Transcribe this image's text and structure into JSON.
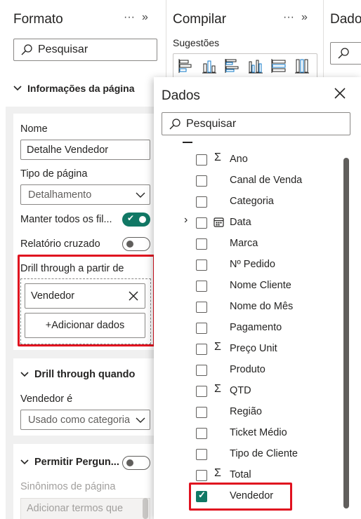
{
  "format_pane": {
    "title": "Formato",
    "more_label": "···",
    "collapse_label": "»",
    "search_placeholder": "Pesquisar",
    "section_title": "Informações da página",
    "name_label": "Nome",
    "name_value": "Detalhe Vendedor",
    "page_type_label": "Tipo de página",
    "page_type_value": "Detalhamento",
    "keep_filters_label": "Manter todos os fil...",
    "cross_report_label": "Relatório cruzado",
    "drill_from_label": "Drill through a partir de",
    "drill_field": "Vendedor",
    "add_data_label": "+Adicionar dados",
    "drill_when_title": "Drill through quando",
    "drill_when_field_label": "Vendedor é",
    "drill_when_value": "Usado como categoria",
    "allow_questions_title": "Permitir Pergun...",
    "synonyms_label": "Sinônimos de página",
    "synonyms_placeholder": "Adicionar termos que"
  },
  "build_pane": {
    "title": "Compilar",
    "more_label": "···",
    "collapse_label": "»",
    "suggestions_label": "Sugestões"
  },
  "data_pane": {
    "title": "Dados"
  },
  "flyout": {
    "title": "Dados",
    "search_placeholder": "Pesquisar",
    "items": [
      {
        "label": "Ano",
        "sigma": true,
        "checked": false
      },
      {
        "label": "Canal de Venda",
        "sigma": false,
        "checked": false
      },
      {
        "label": "Categoria",
        "sigma": false,
        "checked": false
      },
      {
        "label": "Data",
        "sigma": false,
        "checked": false,
        "calendar": true,
        "expandable": true
      },
      {
        "label": "Marca",
        "sigma": false,
        "checked": false
      },
      {
        "label": "Nº Pedido",
        "sigma": false,
        "checked": false
      },
      {
        "label": "Nome Cliente",
        "sigma": false,
        "checked": false
      },
      {
        "label": "Nome do Mês",
        "sigma": false,
        "checked": false
      },
      {
        "label": "Pagamento",
        "sigma": false,
        "checked": false
      },
      {
        "label": "Preço Unit",
        "sigma": true,
        "checked": false
      },
      {
        "label": "Produto",
        "sigma": false,
        "checked": false
      },
      {
        "label": "QTD",
        "sigma": true,
        "checked": false
      },
      {
        "label": "Região",
        "sigma": false,
        "checked": false
      },
      {
        "label": "Ticket Médio",
        "sigma": false,
        "checked": false
      },
      {
        "label": "Tipo de Cliente",
        "sigma": false,
        "checked": false
      },
      {
        "label": "Total",
        "sigma": true,
        "checked": false
      },
      {
        "label": "Vendedor",
        "sigma": false,
        "checked": true
      }
    ]
  },
  "colors": {
    "accent": "#117865",
    "highlight": "#e0111f"
  }
}
